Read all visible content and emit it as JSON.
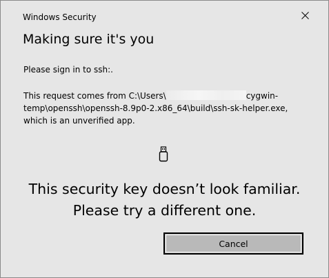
{
  "window": {
    "title": "Windows Security",
    "close_icon": "close-icon"
  },
  "content": {
    "heading": "Making sure it's you",
    "signin_text": "Please sign in to ssh:.",
    "request_line1_pre": "This request comes from C:\\Users\\",
    "request_line1_post": "cygwin-",
    "request_line2": "temp\\openssh\\openssh-8.9p0-2.x86_64\\build\\ssh-sk-helper.exe,",
    "request_line3": "which is an unverified app.",
    "security_key_icon": "usb-security-key-icon",
    "message_line1": "This security key doesn’t look familiar.",
    "message_line2": "Please try a different one."
  },
  "buttons": {
    "cancel_label": "Cancel"
  },
  "colors": {
    "dialog_background": "#e6e6e6",
    "button_background": "#b9b9b9",
    "border": "#8a8a8a"
  }
}
